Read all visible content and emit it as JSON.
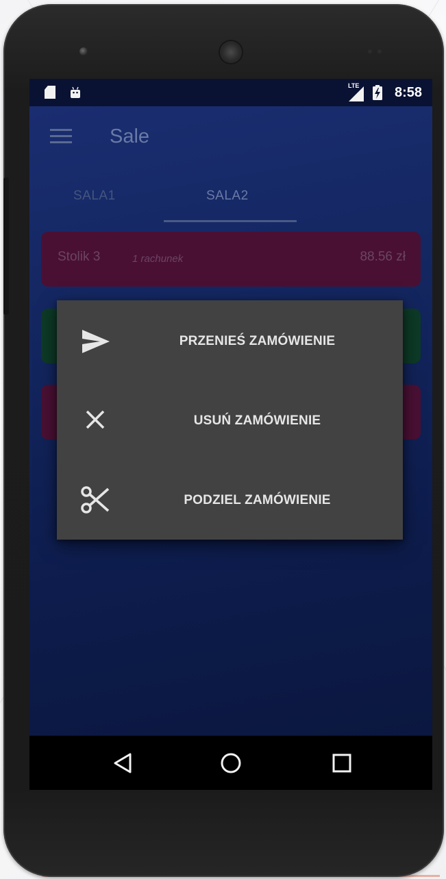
{
  "status_bar": {
    "time": "8:58",
    "network_label": "LTE",
    "icons": [
      "sd-card-icon",
      "android-icon",
      "lte-signal-icon",
      "battery-charging-icon"
    ]
  },
  "app_bar": {
    "title": "Sale",
    "menu_icon": "hamburger-menu-icon"
  },
  "tabs": [
    {
      "label": "SALA1",
      "selected": false
    },
    {
      "label": "SALA2",
      "selected": true
    }
  ],
  "tables": [
    {
      "name": "Stolik 3",
      "subtitle": "1 rachunek",
      "amount": "88.56 zł",
      "color": "#4a1034"
    },
    {
      "name": "",
      "subtitle": "",
      "amount": "",
      "color": "#0d3a27"
    },
    {
      "name": "",
      "subtitle": "",
      "amount": "",
      "color": "#4a1034"
    }
  ],
  "context_menu": {
    "items": [
      {
        "label": "PRZENIEŚ ZAMÓWIENIE",
        "icon": "send-icon"
      },
      {
        "label": "USUŃ ZAMÓWIENIE",
        "icon": "close-icon"
      },
      {
        "label": "PODZIEL ZAMÓWIENIE",
        "icon": "scissors-icon"
      }
    ]
  },
  "nav_bar": {
    "buttons": [
      "back-icon",
      "home-icon",
      "recent-apps-icon"
    ]
  },
  "colors": {
    "menu_background": "#424242",
    "menu_text": "#e6e6e6",
    "screen_background": "#13265f",
    "status_bar": "#0a1233"
  }
}
